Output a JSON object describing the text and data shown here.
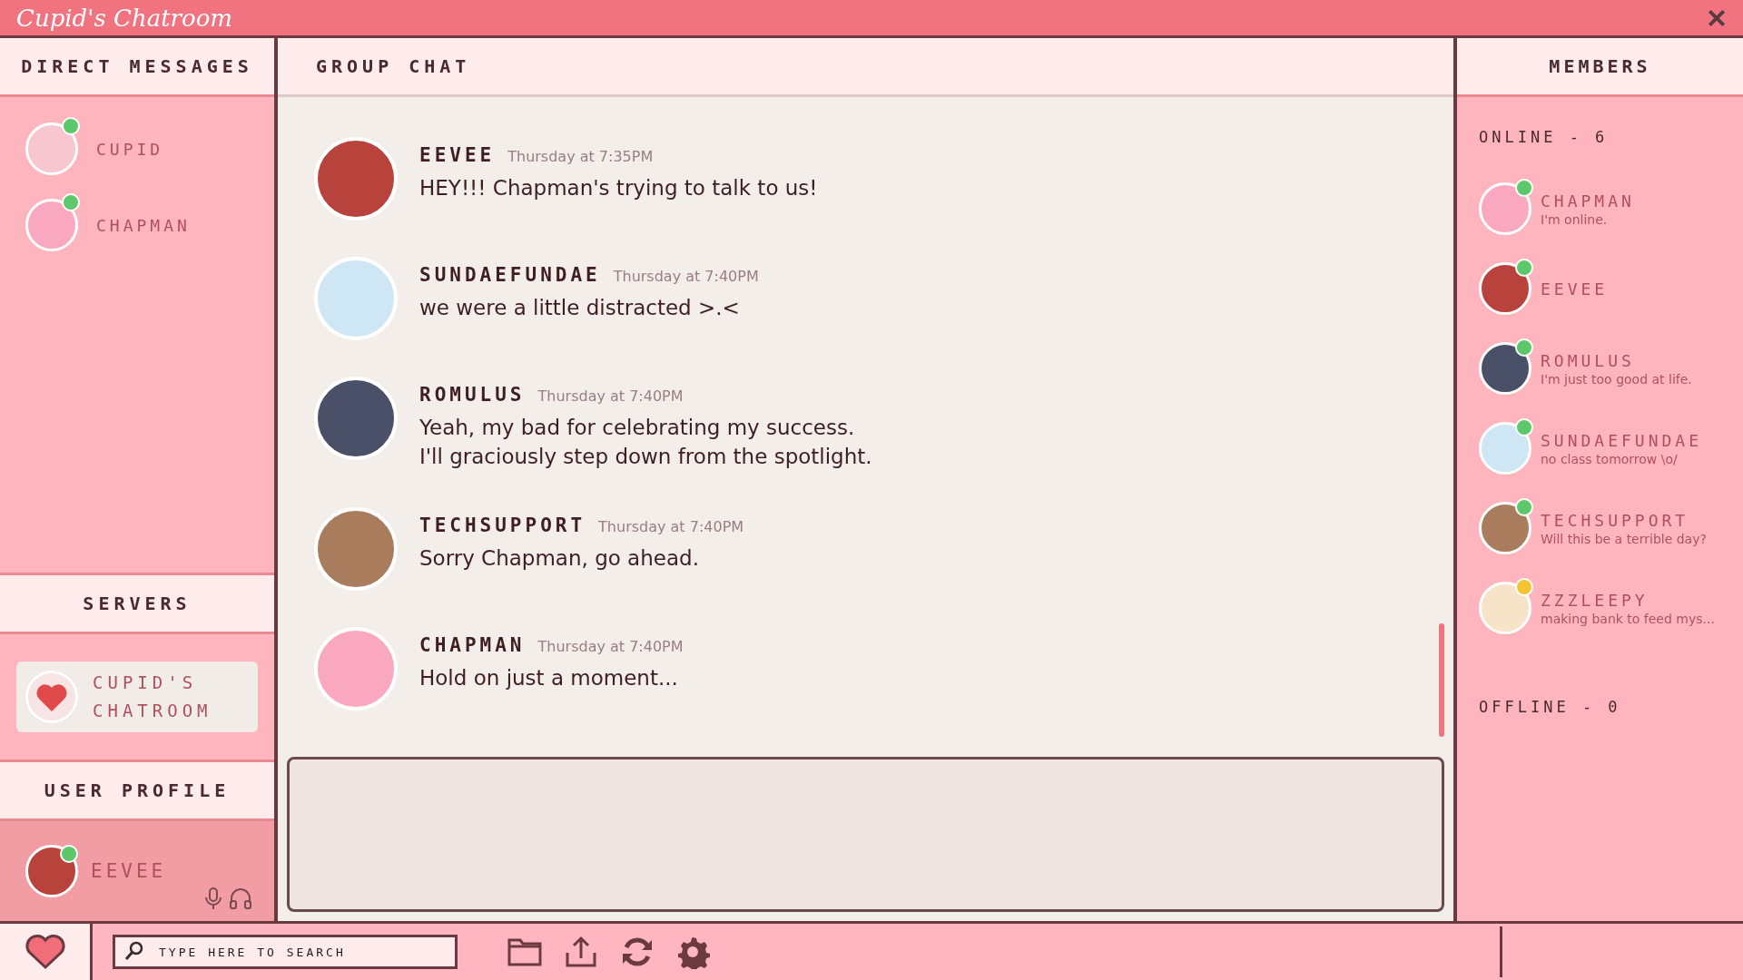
{
  "window": {
    "title": "Cupid's Chatroom"
  },
  "direct_messages": {
    "title": "DIRECT MESSAGES",
    "items": [
      {
        "name": "CUPID",
        "color": "#5cc86a"
      },
      {
        "name": "CHAPMAN",
        "color": "#5cc86a"
      }
    ]
  },
  "servers": {
    "title": "SERVERS",
    "items": [
      {
        "name": "CUPID'S CHATROOM",
        "selected": true
      }
    ]
  },
  "user_profile": {
    "title": "USER PROFILE",
    "name": "EEVEE",
    "color": "#5cc86a"
  },
  "chat": {
    "title": "GROUP CHAT",
    "messages": [
      {
        "author": "EEVEE",
        "time": "Thursday at 7:35PM",
        "text": "HEY!!! Chapman's trying to talk to us!"
      },
      {
        "author": "SUNDAEFUNDAE",
        "time": "Thursday at 7:40PM",
        "text": "we were a little distracted >.<"
      },
      {
        "author": "ROMULUS",
        "time": "Thursday at 7:40PM",
        "text": "Yeah, my bad for celebrating my success.\nI'll graciously step down from the spotlight."
      },
      {
        "author": "TECHSUPPORT",
        "time": "Thursday at 7:40PM",
        "text": "Sorry Chapman, go ahead."
      },
      {
        "author": "CHAPMAN",
        "time": "Thursday at 7:40PM",
        "text": "Hold on just a moment..."
      }
    ]
  },
  "members": {
    "title": "MEMBERS",
    "online_label": "ONLINE - 6",
    "offline_label": "OFFLINE - 0",
    "items": [
      {
        "name": "CHAPMAN",
        "status": "I'm online.",
        "color": "#5cc86a"
      },
      {
        "name": "EEVEE",
        "color": "#5cc86a"
      },
      {
        "name": "ROMULUS",
        "status": "I'm just too good at life.",
        "color": "#5cc86a"
      },
      {
        "name": "SUNDAEFUNDAE",
        "status": "no class tomorrow \\o/",
        "color": "#5cc86a"
      },
      {
        "name": "TECHSUPPORT",
        "status": "Will this be a terrible day?",
        "color": "#5cc86a"
      },
      {
        "name": "ZZZLEEPY",
        "status": "making bank to feed mys...",
        "color": "#f5c531"
      }
    ]
  },
  "taskbar": {
    "search": {
      "placeholder": "TYPE HERE TO SEARCH"
    }
  }
}
